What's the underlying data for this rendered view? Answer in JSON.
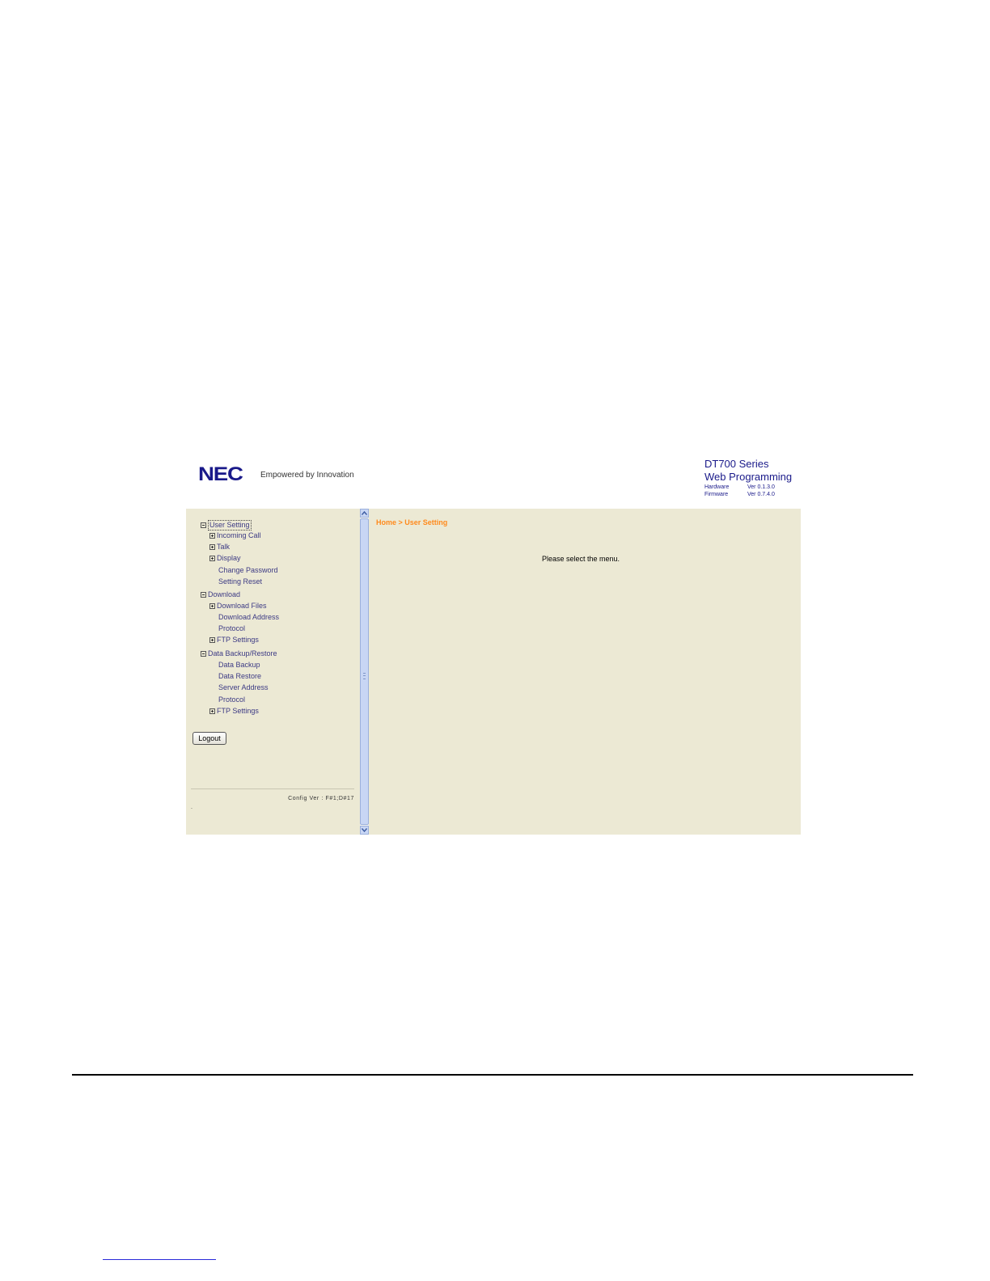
{
  "header": {
    "logo_text": "NEC",
    "tagline": "Empowered by Innovation",
    "product_series": "DT700 Series",
    "product_app": "Web Programming",
    "hardware_label": "Hardware",
    "hardware_version": "Ver 0.1.3.0",
    "firmware_label": "Firmware",
    "firmware_version": "Ver 0.7.4.0"
  },
  "sidebar": {
    "groups": [
      {
        "label": "User Setting",
        "expanded": true,
        "selected": true,
        "items": [
          {
            "label": "Incoming Call",
            "expandable": true
          },
          {
            "label": "Talk",
            "expandable": true
          },
          {
            "label": "Display",
            "expandable": true
          },
          {
            "label": "Change Password",
            "expandable": false
          },
          {
            "label": "Setting Reset",
            "expandable": false
          }
        ]
      },
      {
        "label": "Download",
        "expanded": true,
        "items": [
          {
            "label": "Download Files",
            "expandable": true
          },
          {
            "label": "Download Address",
            "expandable": false
          },
          {
            "label": "Protocol",
            "expandable": false
          },
          {
            "label": "FTP Settings",
            "expandable": true
          }
        ]
      },
      {
        "label": "Data Backup/Restore",
        "expanded": true,
        "items": [
          {
            "label": "Data Backup",
            "expandable": false
          },
          {
            "label": "Data Restore",
            "expandable": false
          },
          {
            "label": "Server Address",
            "expandable": false
          },
          {
            "label": "Protocol",
            "expandable": false
          },
          {
            "label": "FTP Settings",
            "expandable": true
          }
        ]
      }
    ],
    "logout_label": "Logout",
    "config_ver": "Config Ver : F#1;D#17",
    "footer_mark": "."
  },
  "main": {
    "breadcrumb": "Home > User Setting",
    "message": "Please select the menu."
  },
  "colors": {
    "background": "#ece9d4",
    "menu_text": "#3c3a84",
    "breadcrumb": "#ff8a1c",
    "brand": "#1a1a8a"
  }
}
